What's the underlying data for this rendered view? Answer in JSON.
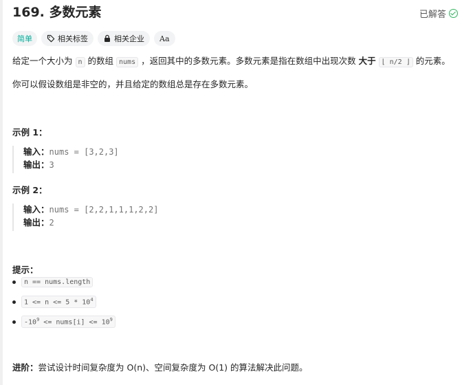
{
  "title": "169. 多数元素",
  "status": "已解答",
  "tags": {
    "difficulty": "简单",
    "related_tags": "相关标签",
    "related_companies": "相关企业",
    "font_toggle": "Aa"
  },
  "description": {
    "p1_a": "给定一个大小为",
    "p1_code_n": "n",
    "p1_b": "的数组",
    "p1_code_nums": "nums",
    "p1_c": "，返回其中的多数元素。多数元素是指在数组中出现次数",
    "p1_bold": "大于",
    "p1_code_floor": "⌊ n/2 ⌋",
    "p1_d": "的元素。",
    "p2": "你可以假设数组是非空的，并且给定的数组总是存在多数元素。"
  },
  "examples": [
    {
      "title": "示例 1：",
      "input_label": "输入：",
      "input": "nums = [3,2,3]",
      "output_label": "输出：",
      "output": "3"
    },
    {
      "title": "示例 2：",
      "input_label": "输入：",
      "input": "nums = [2,2,1,1,1,2,2]",
      "output_label": "输出：",
      "output": "2"
    }
  ],
  "hints": {
    "title": "提示：",
    "items": [
      "n == nums.length"
    ],
    "c2_pre": "1 <= n <= 5 * 10",
    "c2_sup": "4",
    "c3_pre": "-10",
    "c3_sup1": "9",
    "c3_mid": " <= nums[i] <= 10",
    "c3_sup2": "9"
  },
  "advanced": {
    "label": "进阶：",
    "text": "尝试设计时间复杂度为 O(n)、空间复杂度为 O(1) 的算法解决此问题。"
  },
  "colors": {
    "easy": "#00af9b",
    "solved": "#2db55d"
  }
}
